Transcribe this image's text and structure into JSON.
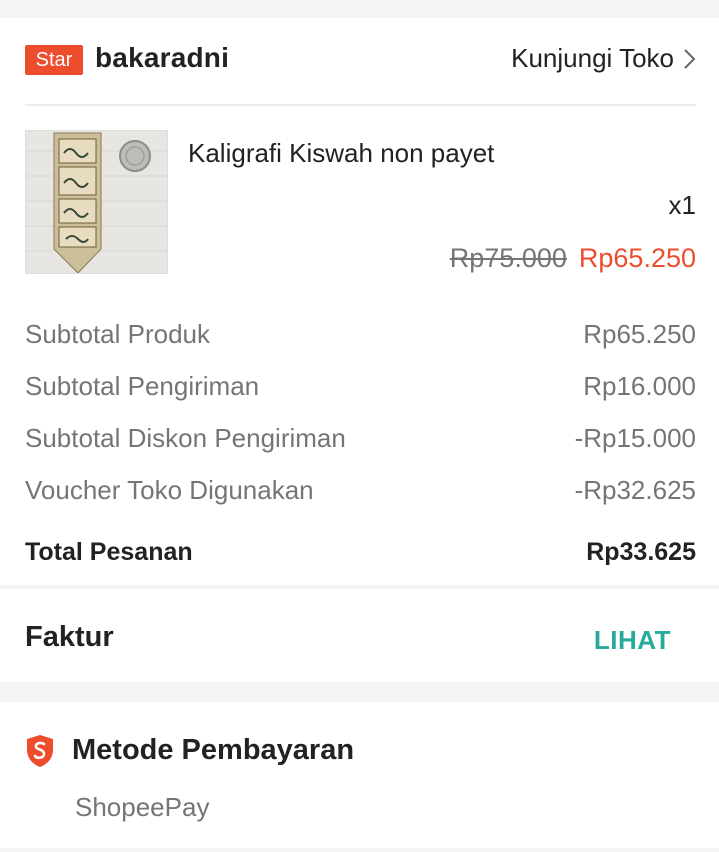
{
  "shop": {
    "badge": "Star",
    "name": "bakaradni",
    "visit_label": "Kunjungi Toko"
  },
  "product": {
    "name": "Kaligrafi Kiswah non payet",
    "quantity": "x1",
    "price_original": "Rp75.000",
    "price_discounted": "Rp65.250"
  },
  "summary": {
    "rows": [
      {
        "label": "Subtotal Produk",
        "value": "Rp65.250"
      },
      {
        "label": "Subtotal Pengiriman",
        "value": "Rp16.000"
      },
      {
        "label": "Subtotal Diskon Pengiriman",
        "value": "-Rp15.000"
      },
      {
        "label": "Voucher Toko Digunakan",
        "value": "-Rp32.625"
      }
    ],
    "total_label": "Total Pesanan",
    "total_value": "Rp33.625"
  },
  "invoice": {
    "label": "Faktur",
    "link": "LIHAT"
  },
  "payment": {
    "title": "Metode Pembayaran",
    "method": "ShopeePay"
  },
  "colors": {
    "brand": "#ee4d2d",
    "link": "#26aa99",
    "muted": "#757575"
  },
  "icons": {
    "chevron": "chevron-right-icon",
    "payment": "shopee-shield-icon"
  }
}
